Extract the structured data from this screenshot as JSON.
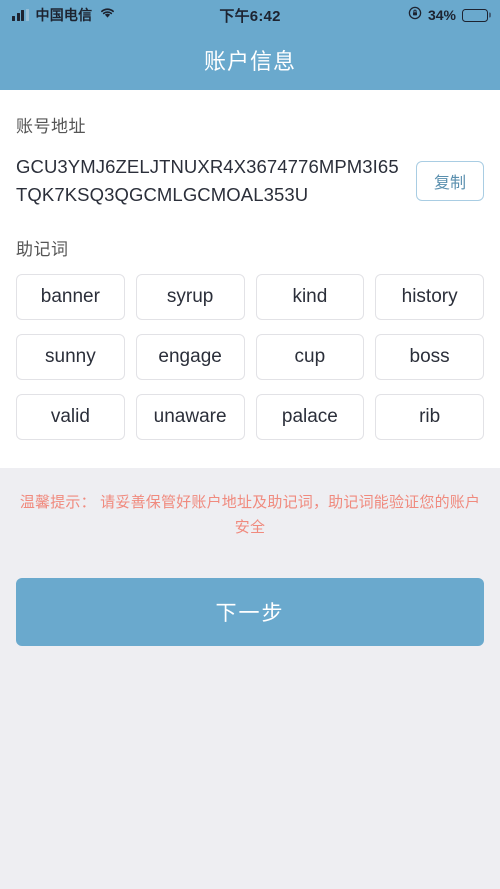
{
  "colors": {
    "brand_blue": "#6aa9cd",
    "card_white": "#ffffff",
    "page_background": "#eeeef2",
    "warning_red": "#f08a7e",
    "copy_border": "#a9cde3",
    "chip_border": "#e2e2e6",
    "text_dark": "#2b2f3a"
  },
  "status_bar": {
    "signal_icon": "signal-bars-icon",
    "carrier": "中国电信",
    "wifi_icon": "wifi-icon",
    "time": "下午6:42",
    "rotation_lock_icon": "rotation-lock-icon",
    "battery_percent": "34%",
    "battery_level": 34,
    "battery_icon": "battery-icon"
  },
  "header": {
    "title": "账户信息"
  },
  "account_address": {
    "label": "账号地址",
    "value": "GCU3YMJ6ZELJTNUXR4X3674776MPM3I65TQK7KSQ3QGCMLGCMOAL353U",
    "copy_button_label": "复制"
  },
  "mnemonic": {
    "label": "助记词",
    "words": [
      "banner",
      "syrup",
      "kind",
      "history",
      "sunny",
      "engage",
      "cup",
      "boss",
      "valid",
      "unaware",
      "palace",
      "rib"
    ]
  },
  "warning": {
    "text": "温馨提示： 请妥善保管好账户地址及助记词，助记词能验证您的账户安全"
  },
  "footer": {
    "next_button_label": "下一步"
  }
}
